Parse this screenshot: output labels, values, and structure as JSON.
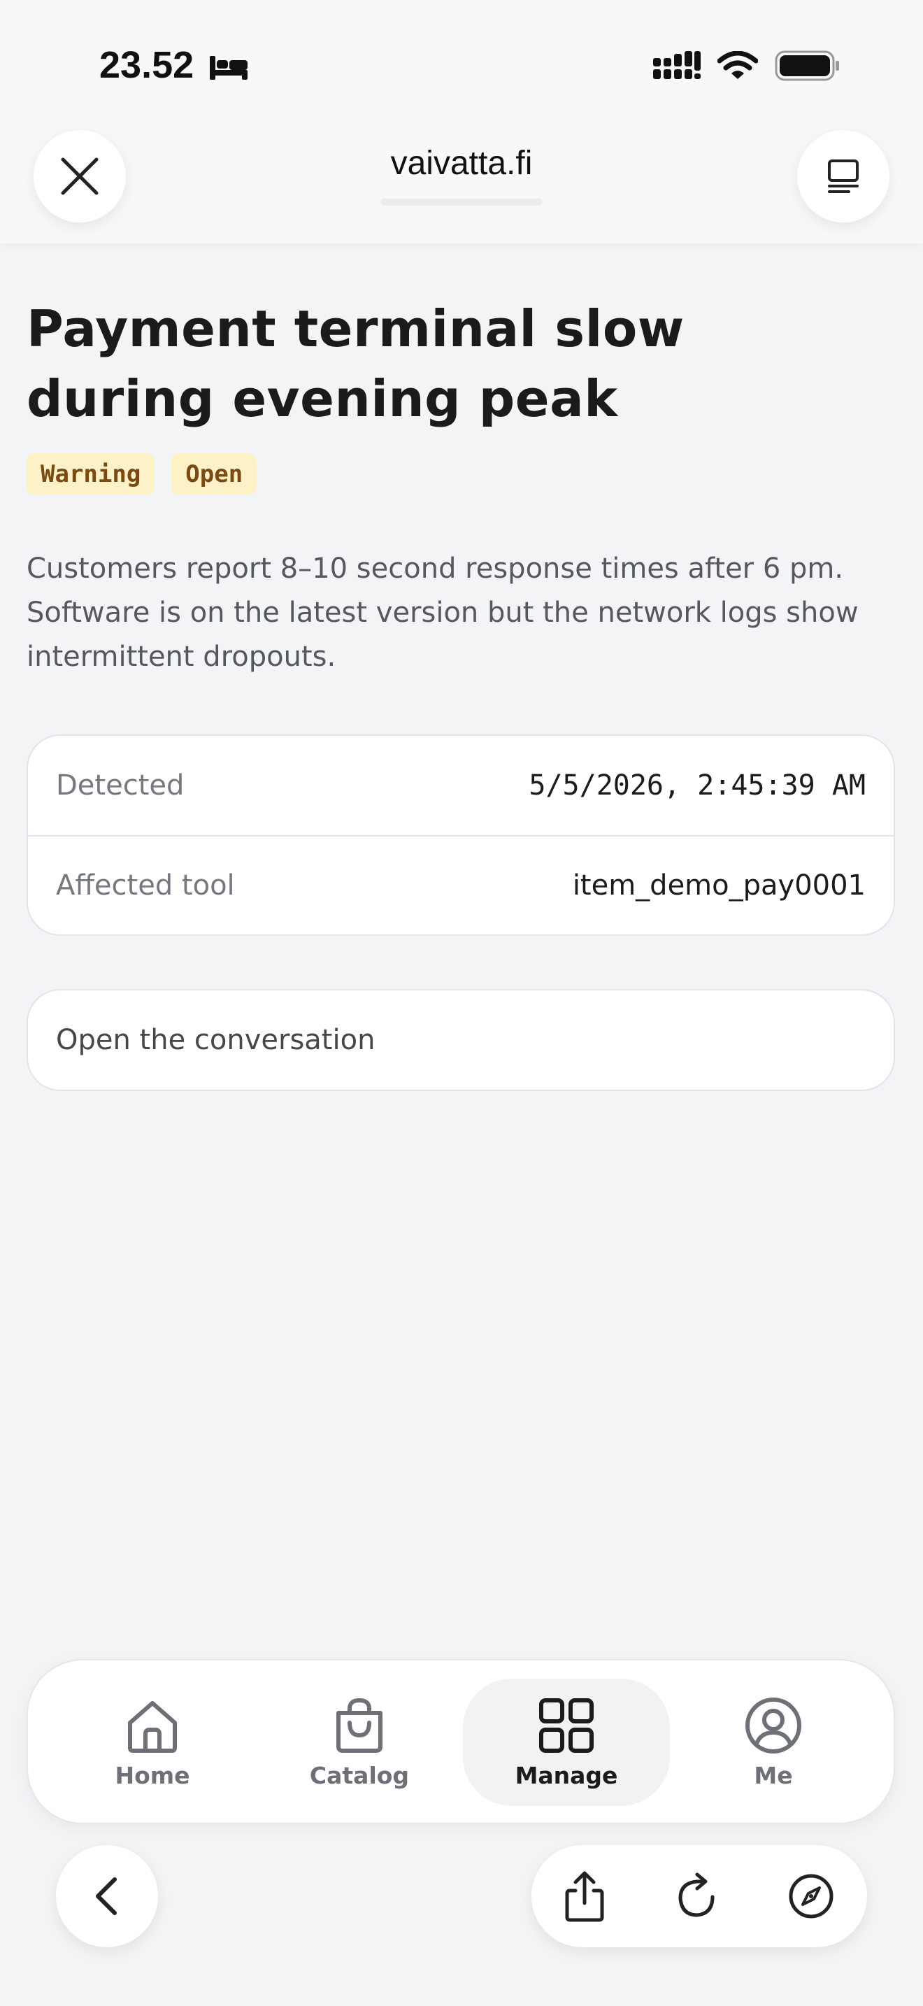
{
  "status_bar": {
    "time": "23.52"
  },
  "browser": {
    "url": "vaivatta.fi"
  },
  "issue": {
    "title": "Payment terminal slow during evening peak",
    "badges": [
      "Warning",
      "Open"
    ],
    "description": "Customers report 8–10 second response times after 6 pm. Software is on the latest version but the network logs show intermittent dropouts.",
    "details": [
      {
        "label": "Detected",
        "value": "5/5/2026, 2:45:39 AM"
      },
      {
        "label": "Affected tool",
        "value": "item_demo_pay0001"
      }
    ],
    "conversation_link": "Open the conversation"
  },
  "tabs": [
    {
      "label": "Home",
      "icon": "home-icon",
      "active": false
    },
    {
      "label": "Catalog",
      "icon": "bag-icon",
      "active": false
    },
    {
      "label": "Manage",
      "icon": "grid-icon",
      "active": true
    },
    {
      "label": "Me",
      "icon": "user-icon",
      "active": false
    }
  ],
  "colors": {
    "badge_bg": "#fdf1c8",
    "badge_text": "#7a4a12",
    "background": "#f3f4f6"
  }
}
